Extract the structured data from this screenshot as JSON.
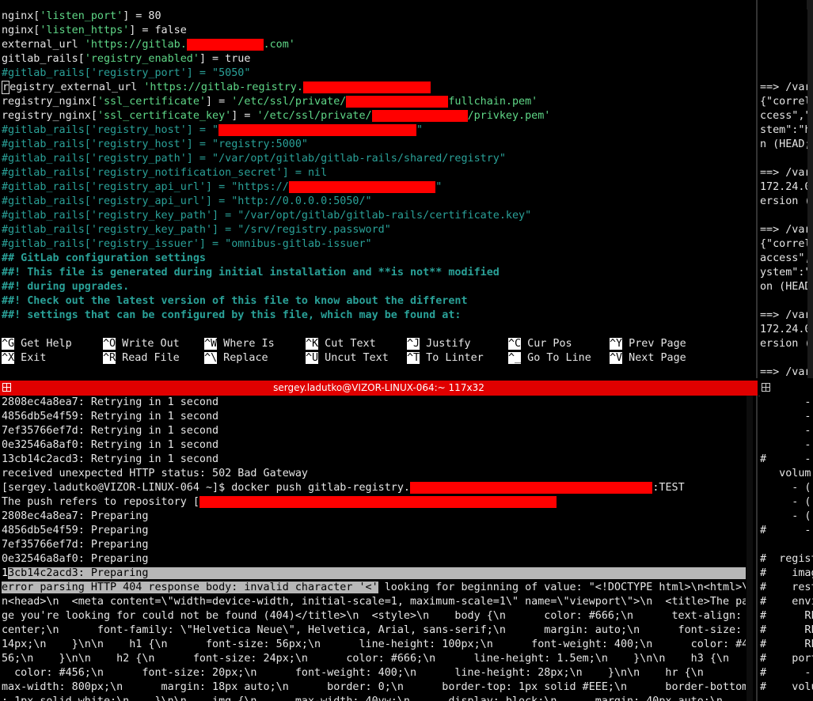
{
  "nano": {
    "lines": [
      [
        {
          "t": "nginx[",
          "c": ""
        },
        {
          "t": "'listen_port'",
          "c": "str"
        },
        {
          "t": "] = 80",
          "c": ""
        }
      ],
      [
        {
          "t": "nginx[",
          "c": ""
        },
        {
          "t": "'listen_https'",
          "c": "str"
        },
        {
          "t": "] = false",
          "c": ""
        }
      ],
      [
        {
          "t": "external_url ",
          "c": ""
        },
        {
          "t": "'https://gitlab.",
          "c": "str"
        },
        {
          "t": "XXXXXXXXXXXX",
          "c": "red"
        },
        {
          "t": ".com'",
          "c": "str"
        }
      ],
      [
        {
          "t": "gitlab_rails[",
          "c": ""
        },
        {
          "t": "'registry_enabled'",
          "c": "str"
        },
        {
          "t": "] = true",
          "c": ""
        }
      ],
      [
        {
          "t": "#gitlab_rails['registry_port'] = \"5050\"",
          "c": "cmt"
        }
      ],
      [
        {
          "t": "registry_external_url ",
          "c": ""
        },
        {
          "t": "'https://gitlab-registry.",
          "c": "str"
        },
        {
          "t": "XXXXXXXXXXXXXXXXXXXX",
          "c": "red"
        }
      ],
      [
        {
          "t": "registry_nginx[",
          "c": ""
        },
        {
          "t": "'ssl_certificate'",
          "c": "str"
        },
        {
          "t": "] = ",
          "c": ""
        },
        {
          "t": "'/etc/ssl/private/",
          "c": "str"
        },
        {
          "t": "XXXXXXXXXXXXXXXX",
          "c": "red"
        },
        {
          "t": "fullchain.pem'",
          "c": "str"
        }
      ],
      [
        {
          "t": "registry_nginx[",
          "c": ""
        },
        {
          "t": "'ssl_certificate_key'",
          "c": "str"
        },
        {
          "t": "] = ",
          "c": ""
        },
        {
          "t": "'/etc/ssl/private/",
          "c": "str"
        },
        {
          "t": "XXXXXXXXXXXXXXX",
          "c": "red"
        },
        {
          "t": "/privkey.pem'",
          "c": "str"
        }
      ],
      [
        {
          "t": "#gitlab_rails['registry_host'] = \"",
          "c": "cmt"
        },
        {
          "t": "XXXXXXXXXXXXXXXXXXXXXXXXXXXXXXX",
          "c": "red"
        },
        {
          "t": "\"",
          "c": "cmt"
        }
      ],
      [
        {
          "t": "#gitlab_rails['registry_host'] = \"registry:5000\"",
          "c": "cmt"
        }
      ],
      [
        {
          "t": "#gitlab_rails['registry_path'] = \"/var/opt/gitlab/gitlab-rails/shared/registry\"",
          "c": "cmt"
        }
      ],
      [
        {
          "t": "#gitlab_rails['registry_notification_secret'] = nil",
          "c": "cmt"
        }
      ],
      [
        {
          "t": "#gitlab_rails['registry_api_url'] = \"https://",
          "c": "cmt"
        },
        {
          "t": "XXXXXXXXXXXXXXXXXXXXXXX",
          "c": "red"
        },
        {
          "t": "\"",
          "c": "cmt"
        }
      ],
      [
        {
          "t": "#gitlab_rails['registry_api_url'] = \"http://0.0.0.0:5050/\"",
          "c": "cmt"
        }
      ],
      [
        {
          "t": "#gitlab_rails['registry_key_path'] = \"/var/opt/gitlab/gitlab-rails/certificate.key\"",
          "c": "cmt"
        }
      ],
      [
        {
          "t": "#gitlab_rails['registry_key_path'] = \"/srv/registry.password\"",
          "c": "cmt"
        }
      ],
      [
        {
          "t": "#gitlab_rails['registry_issuer'] = \"omnibus-gitlab-issuer\"",
          "c": "cmt"
        }
      ],
      [
        {
          "t": "## GitLab configuration settings",
          "c": "cmt bold"
        }
      ],
      [
        {
          "t": "##! This file is generated during initial installation and **is not** modified",
          "c": "cmt bold"
        }
      ],
      [
        {
          "t": "##! during upgrades.",
          "c": "cmt bold"
        }
      ],
      [
        {
          "t": "##! Check out the latest version of this file to know about the different",
          "c": "cmt bold"
        }
      ],
      [
        {
          "t": "##! settings that can be configured by this file, which may be found at:",
          "c": "cmt bold"
        }
      ]
    ],
    "shortcuts_row1": [
      {
        "key": "^G",
        "label": "Get Help"
      },
      {
        "key": "^O",
        "label": "Write Out"
      },
      {
        "key": "^W",
        "label": "Where Is"
      },
      {
        "key": "^K",
        "label": "Cut Text"
      },
      {
        "key": "^J",
        "label": "Justify"
      },
      {
        "key": "^C",
        "label": "Cur Pos"
      },
      {
        "key": "^Y",
        "label": "Prev Page"
      }
    ],
    "shortcuts_row2": [
      {
        "key": "^X",
        "label": "Exit"
      },
      {
        "key": "^R",
        "label": "Read File"
      },
      {
        "key": "^\\",
        "label": "Replace"
      },
      {
        "key": "^U",
        "label": "Uncut Text"
      },
      {
        "key": "^T",
        "label": "To Linter"
      },
      {
        "key": "^_",
        "label": "Go To Line"
      },
      {
        "key": "^V",
        "label": "Next Page"
      }
    ]
  },
  "terminal": {
    "title": "sergey.ladutko@VIZOR-LINUX-064:~ 117x32",
    "lines": [
      [
        {
          "t": "2808ec4a8ea7: Retrying in 1 second",
          "c": ""
        }
      ],
      [
        {
          "t": "4856db5e4f59: Retrying in 1 second",
          "c": ""
        }
      ],
      [
        {
          "t": "7ef35766ef7d: Retrying in 1 second",
          "c": ""
        }
      ],
      [
        {
          "t": "0e32546a8af0: Retrying in 1 second",
          "c": ""
        }
      ],
      [
        {
          "t": "13cb14c2acd3: Retrying in 1 second",
          "c": ""
        }
      ],
      [
        {
          "t": "received unexpected HTTP status: 502 Bad Gateway",
          "c": ""
        }
      ],
      [
        {
          "t": "[sergey.ladutko@VIZOR-LINUX-064 ~]$ docker push gitlab-registry.",
          "c": ""
        },
        {
          "t": "XXXXXXXXXXXXXXXXXXXXXXXXXXXXXXXXXXXXXX",
          "c": "red"
        },
        {
          "t": ":TEST",
          "c": ""
        }
      ],
      [
        {
          "t": "The push refers to repository [",
          "c": ""
        },
        {
          "t": "XXXXXXXXXXXXXXXXXXXXXXXXXXXXXXXXXXXXXXXXXXXXXXXXXXXXXXXX",
          "c": "red"
        }
      ],
      [
        {
          "t": "2808ec4a8ea7: Preparing",
          "c": ""
        }
      ],
      [
        {
          "t": "4856db5e4f59: Preparing",
          "c": ""
        }
      ],
      [
        {
          "t": "7ef35766ef7d: Preparing",
          "c": ""
        }
      ],
      [
        {
          "t": "0e32546a8af0: Preparing",
          "c": ""
        }
      ],
      [
        {
          "t": "13cb14c2acd3: Preparing                                                                                              ",
          "c": "sel"
        }
      ],
      [
        {
          "t": "error parsing HTTP 404 response body: invalid character '<'",
          "c": "sel"
        },
        {
          "t": " looking for beginning of value: \"<!DOCTYPE html>\\n<html>\\",
          "c": ""
        }
      ],
      [
        {
          "t": "n<head>\\n  <meta content=\\\"width=device-width, initial-scale=1, maximum-scale=1\\\" name=\\\"viewport\\\">\\n  <title>The pa",
          "c": ""
        }
      ],
      [
        {
          "t": "ge you're looking for could not be found (404)</title>\\n  <style>\\n    body {\\n      color: #666;\\n      text-align:",
          "c": ""
        }
      ],
      [
        {
          "t": "center;\\n      font-family: \\\"Helvetica Neue\\\", Helvetica, Arial, sans-serif;\\n      margin: auto;\\n      font-size:",
          "c": ""
        }
      ],
      [
        {
          "t": "14px;\\n    }\\n\\n    h1 {\\n      font-size: 56px;\\n      line-height: 100px;\\n      font-weight: 400;\\n      color: #4",
          "c": ""
        }
      ],
      [
        {
          "t": "56;\\n    }\\n\\n    h2 {\\n      font-size: 24px;\\n      color: #666;\\n      line-height: 1.5em;\\n    }\\n\\n    h3 {\\n",
          "c": ""
        }
      ],
      [
        {
          "t": "  color: #456;\\n      font-size: 20px;\\n      font-weight: 400;\\n      line-height: 28px;\\n    }\\n\\n    hr {\\n",
          "c": ""
        }
      ],
      [
        {
          "t": "max-width: 800px;\\n      margin: 18px auto;\\n      border: 0;\\n      border-top: 1px solid #EEE;\\n      border-bottom",
          "c": ""
        }
      ],
      [
        {
          "t": ": 1px solid white;\\n    }\\n\\n    img {\\n      max-width: 40vw;\\n      display: block;\\n      margin: 40px auto;\\n",
          "c": ""
        }
      ]
    ]
  },
  "right_top": {
    "lines": [
      "",
      "",
      "",
      "",
      "",
      "==> /var",
      "{\"correl",
      "ccess\",\"",
      "stem\":\"h",
      "n (HEAD;",
      "",
      "==> /var",
      "172.24.0",
      "ersion (",
      "",
      "==> /var",
      "{\"correl",
      "access\",",
      "ystem\":\"",
      "on (HEAD",
      "",
      "==> /var",
      "172.24.0",
      "ersion (",
      "",
      "==> /var",
      "{\"correl"
    ]
  },
  "right_bottom": {
    "lines": [
      "       -",
      "       -",
      "       -",
      "       -",
      "#      -",
      "   volum",
      "     - (",
      "     - (",
      "     - (",
      "#      -",
      "",
      "#  regist",
      "#    imag",
      "#    rest",
      "#    envi",
      "#      RE",
      "#      RE",
      "#      RE",
      "#    port",
      "#      -",
      "#    volu"
    ]
  }
}
